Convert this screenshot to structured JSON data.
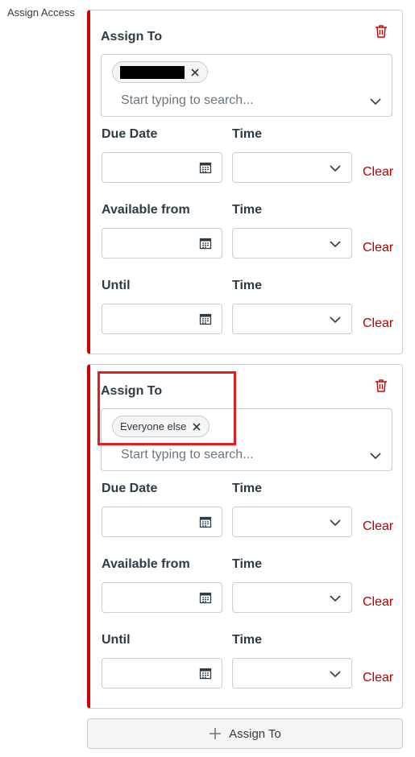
{
  "side_label": "Assign Access",
  "colors": {
    "accent": "#d00000",
    "clear": "#b50000",
    "highlight": "#e02020"
  },
  "cards": [
    {
      "heading": "Assign To",
      "chip": {
        "label": "",
        "redacted": true
      },
      "search_placeholder": "Start typing to search...",
      "due_date_label": "Due Date",
      "available_from_label": "Available from",
      "until_label": "Until",
      "time_label": "Time",
      "clear_label": "Clear"
    },
    {
      "heading": "Assign To",
      "chip": {
        "label": "Everyone else",
        "redacted": false
      },
      "search_placeholder": "Start typing to search...",
      "due_date_label": "Due Date",
      "available_from_label": "Available from",
      "until_label": "Until",
      "time_label": "Time",
      "clear_label": "Clear"
    }
  ],
  "add_button_label": "Assign To",
  "icons": [
    "trash-icon",
    "close-icon",
    "chevron-down-icon",
    "calendar-icon",
    "plus-icon"
  ]
}
